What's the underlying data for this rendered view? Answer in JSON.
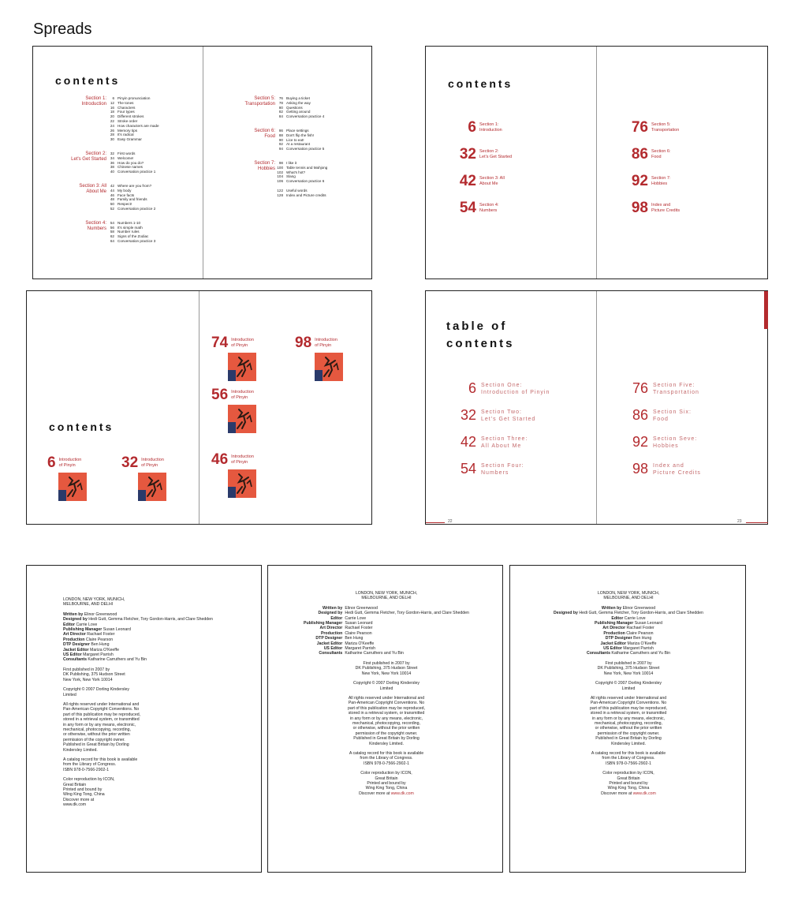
{
  "heading": "Spreads",
  "spread1": {
    "title": "contents",
    "left_sections": [
      {
        "name": "Section 1:\nIntroduction",
        "rows": [
          [
            "6",
            "Pinyin pronunciation"
          ],
          [
            "12",
            "The tones"
          ],
          [
            "16",
            "Characters"
          ],
          [
            "18",
            "Four types"
          ],
          [
            "20",
            "Different strokes"
          ],
          [
            "22",
            "Stroke order"
          ],
          [
            "24",
            "How characters are made"
          ],
          [
            "26",
            "Memory tips"
          ],
          [
            "28",
            "It's radical"
          ],
          [
            "30",
            "Easy Grammar"
          ]
        ]
      },
      {
        "name": "Section 2:\nLet's Get Started",
        "rows": [
          [
            "32",
            "First words"
          ],
          [
            "34",
            "Welcome!"
          ],
          [
            "36",
            "How do you do?"
          ],
          [
            "38",
            "Chinese names"
          ],
          [
            "40",
            "Conversation practice 1"
          ]
        ]
      },
      {
        "name": "Section 3: All\nAbout Me",
        "rows": [
          [
            "42",
            "Where are you from?"
          ],
          [
            "44",
            "My body"
          ],
          [
            "46",
            "Face facts"
          ],
          [
            "48",
            "Family and friends"
          ],
          [
            "50",
            "Respect!"
          ],
          [
            "52",
            "Conversation practice 2"
          ]
        ]
      },
      {
        "name": "Section 4:\nNumbers",
        "rows": [
          [
            "54",
            "Numbers 1-10"
          ],
          [
            "56",
            "It's simple math"
          ],
          [
            "58",
            "Number rules"
          ],
          [
            "62",
            "Signs of the Zodiac"
          ],
          [
            "64",
            "Conversation practice 3"
          ]
        ]
      }
    ],
    "right_sections": [
      {
        "name": "Section 5:\nTransportation",
        "rows": [
          [
            "76",
            "Buying a ticket"
          ],
          [
            "78",
            "Asking the way"
          ],
          [
            "80",
            "Questions"
          ],
          [
            "82",
            "Getting around"
          ],
          [
            "84",
            "Conversation practice 4"
          ]
        ]
      },
      {
        "name": "Section 6:\nFood",
        "rows": [
          [
            "86",
            "Place settings"
          ],
          [
            "88",
            "Don't flip the fish!"
          ],
          [
            "90",
            "Lice to eat!"
          ],
          [
            "92",
            "At a restaurant"
          ],
          [
            "94",
            "Conversation practice 5"
          ]
        ]
      },
      {
        "name": "Section 7:\nHobbies",
        "rows": [
          [
            "98",
            "I like it"
          ],
          [
            "100",
            "Table tennis and Mahjong"
          ],
          [
            "102",
            "What's hot?"
          ],
          [
            "104",
            "Slang"
          ],
          [
            "106",
            "Conversation practice 6"
          ],
          [
            "",
            ""
          ],
          [
            "122",
            "Useful words"
          ],
          [
            "128",
            "Index and Picture credits"
          ]
        ]
      }
    ]
  },
  "spread2": {
    "title": "contents",
    "left": [
      {
        "num": "6",
        "label": "Section 1:\nIntroduction"
      },
      {
        "num": "32",
        "label": "Section 2:\nLet's Get Started"
      },
      {
        "num": "42",
        "label": "Section 3: All\nAbout Me"
      },
      {
        "num": "54",
        "label": "Section 4:\nNumbers"
      }
    ],
    "right": [
      {
        "num": "76",
        "label": "Section 5:\nTransportation"
      },
      {
        "num": "86",
        "label": "Section 6:\nFood"
      },
      {
        "num": "92",
        "label": "Section 7:\nHobbies"
      },
      {
        "num": "98",
        "label": "Index and\nPicture Credits"
      }
    ]
  },
  "spread3": {
    "title": "contents",
    "items": [
      {
        "num": "6",
        "label": "Introduction\nof Pinyin"
      },
      {
        "num": "32",
        "label": "Introduction\nof Pinyin"
      },
      {
        "num": "74",
        "label": "Introduction\nof Pinyin"
      },
      {
        "num": "98",
        "label": "Introduction\nof Pinyin"
      },
      {
        "num": "56",
        "label": "Introduction\nof Pinyin"
      },
      {
        "num": "46",
        "label": "Introduction\nof Pinyin"
      }
    ]
  },
  "spread4": {
    "title_line1": "table of",
    "title_line2": "contents",
    "left": [
      {
        "num": "6",
        "label": "Section One:\nIntroduction of Pinyin"
      },
      {
        "num": "32",
        "label": "Section Two:\nLet's Get Started"
      },
      {
        "num": "42",
        "label": "Section Three:\nAll About Me"
      },
      {
        "num": "54",
        "label": "Section Four:\nNumbers"
      }
    ],
    "right": [
      {
        "num": "76",
        "label": "Section Five:\nTransportation"
      },
      {
        "num": "86",
        "label": "Section Six:\nFood"
      },
      {
        "num": "92",
        "label": "Section Seve:\nHobbies"
      },
      {
        "num": "98",
        "label": "Index and\nPicture Credits"
      }
    ],
    "folio_left": "22",
    "folio_right": "23"
  },
  "imprint": {
    "cities_line1": "LONDON, NEW YORK, MUNICH,",
    "cities_line2": "MELBOURNE, AND DELHI",
    "credits": [
      {
        "k": "Written by",
        "v": "Elinor Greenwood"
      },
      {
        "k": "Designed by",
        "v": "Hedi Gutt, Gemma Fletcher, Tory Gordon-Harris, and Clare Shedden"
      },
      {
        "k": "Editor",
        "v": "Carrie Love"
      },
      {
        "k": "Publishing Manager",
        "v": "Susan Leonard"
      },
      {
        "k": "Art Director",
        "v": "Rachael Foster"
      },
      {
        "k": "Production",
        "v": "Claire Pearson"
      },
      {
        "k": "DTP Designer",
        "v": "Ben Hung"
      },
      {
        "k": "Jacket Editor",
        "v": "Mariza O'Keeffe"
      },
      {
        "k": "US Editor",
        "v": "Margaret Parrish"
      },
      {
        "k": "Consultants",
        "v": "Katharine Carruthers and Yu Bin"
      }
    ],
    "first_published": [
      "First published in 2007 by",
      "DK Publishing, 375 Hudson Street",
      "New York, New York 10014"
    ],
    "copyright": [
      "Copyright © 2007 Dorling Kindersley",
      "Limited"
    ],
    "rights": [
      "All rights reserved under International and",
      "Pan-American Copyright Conventions. No",
      "part of this publication may be reproduced,",
      "stored in a retrieval system, or transmitted",
      "in any form or by any means, electronic,",
      "mechanical, photocopying, recording,",
      "or otherwise, without the prior written",
      "permission of the copyright owner.",
      "Published in Great Britain by Dorling",
      "Kindersley Limited."
    ],
    "catalog": [
      "A catalog record for this book is available",
      "from the Library of Congress.",
      "ISBN 978-0-7566-2902-1"
    ],
    "color": [
      "Color reproduction by ICON,",
      "Great Britain",
      "Printed and bound by",
      "Wing King Tong, China"
    ],
    "discover_label": "Discover more at",
    "discover_url": "www.dk.com"
  }
}
